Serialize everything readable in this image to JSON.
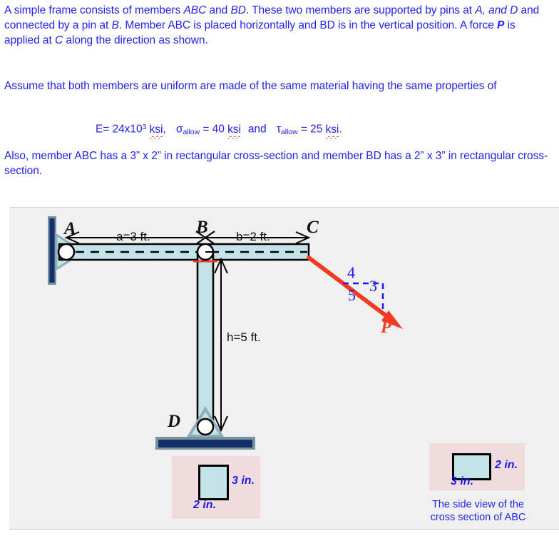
{
  "problem": {
    "paragraph1_parts": {
      "t1": "A simple frame consists of members ",
      "abc": "ABC",
      "t2": " and ",
      "bd": "BD",
      "t3": ".  These two members are supported by pins at ",
      "a": "A,",
      "t4": " ",
      "and_d": "and D",
      "t5": " and connected by a pin at ",
      "b": "B",
      "t6": ".  Member ABC is placed horizontally and BD is in the vertical position. A force ",
      "p": "P",
      "t7": " is applied at ",
      "c": "C",
      "t8": "  along the direction as shown."
    },
    "paragraph2": "Assume that both members are uniform are made of the same material having the same properties of",
    "formula": {
      "e_label": "E= 24x10",
      "e_exp": "3",
      "e_unit": "ksi",
      "comma": ",",
      "sigma": "σ",
      "sigma_sub": "allow",
      "sigma_eq": " = 40 ",
      "sigma_unit": "ksi",
      "and": "and",
      "tau": "τ",
      "tau_sub": "allow",
      "tau_eq": " = 25 ",
      "tau_unit": "ksi",
      "period": "."
    },
    "paragraph3": "Also, member ABC has a 3” x 2” in rectangular cross-section and member BD has a 2” x 3” in rectangular cross-section."
  },
  "figure": {
    "nodes": {
      "a": "A",
      "b": "B",
      "c": "C",
      "d": "D",
      "p": "P"
    },
    "dimensions": {
      "a": "a=3 ft.",
      "b": "b=2 ft.",
      "h": "h=5 ft."
    },
    "force_triangle": {
      "horizontal": "4",
      "vertical": "3",
      "hypotenuse": "5"
    },
    "cross_section_abc": {
      "height_label": "2 in.",
      "width_label": "3 in.",
      "caption": "The side view of the cross section of ABC"
    },
    "cross_section_bd": {
      "height_label": "3 in.",
      "width_label": "2 in."
    },
    "colors": {
      "member_fill": "#c4e3e8",
      "member_stroke": "#000000",
      "support_wall": "#14306a",
      "support_wall_border": "#7a92a0",
      "force_arrow": "#f23b22",
      "triangle_blue": "#1a1aee",
      "callout_bg": "#f0dcdc",
      "text_blue": "#2222ee",
      "figure_bg": "#f0f0f0"
    }
  }
}
